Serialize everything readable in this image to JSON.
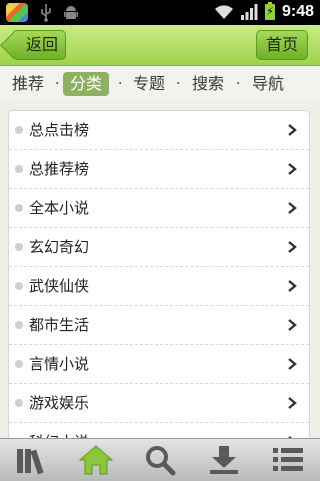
{
  "status_bar": {
    "time": "9:48",
    "battery_glyph": "⚡",
    "icons": [
      "app-badge-icon",
      "usb-icon",
      "android-icon",
      "wifi-icon",
      "signal-icon",
      "battery-icon"
    ]
  },
  "header": {
    "back_label": "返回",
    "home_label": "首页"
  },
  "nav": {
    "tabs": [
      {
        "label": "推荐"
      },
      {
        "label": "分类",
        "active": true
      },
      {
        "label": "专题"
      },
      {
        "label": "搜索"
      },
      {
        "label": "导航"
      }
    ],
    "separator": "·"
  },
  "list": {
    "items": [
      "总点击榜",
      "总推荐榜",
      "全本小说",
      "玄幻奇幻",
      "武侠仙侠",
      "都市生活",
      "言情小说",
      "游戏娱乐",
      "科幻小说"
    ]
  },
  "toolbar": {
    "buttons": [
      "bookshelf-icon",
      "home-icon",
      "search-icon",
      "download-icon",
      "menu-icon"
    ]
  },
  "colors": {
    "header_green": "#9fd24a",
    "active_tab": "#8db063",
    "home_icon": "#8bc63d"
  }
}
